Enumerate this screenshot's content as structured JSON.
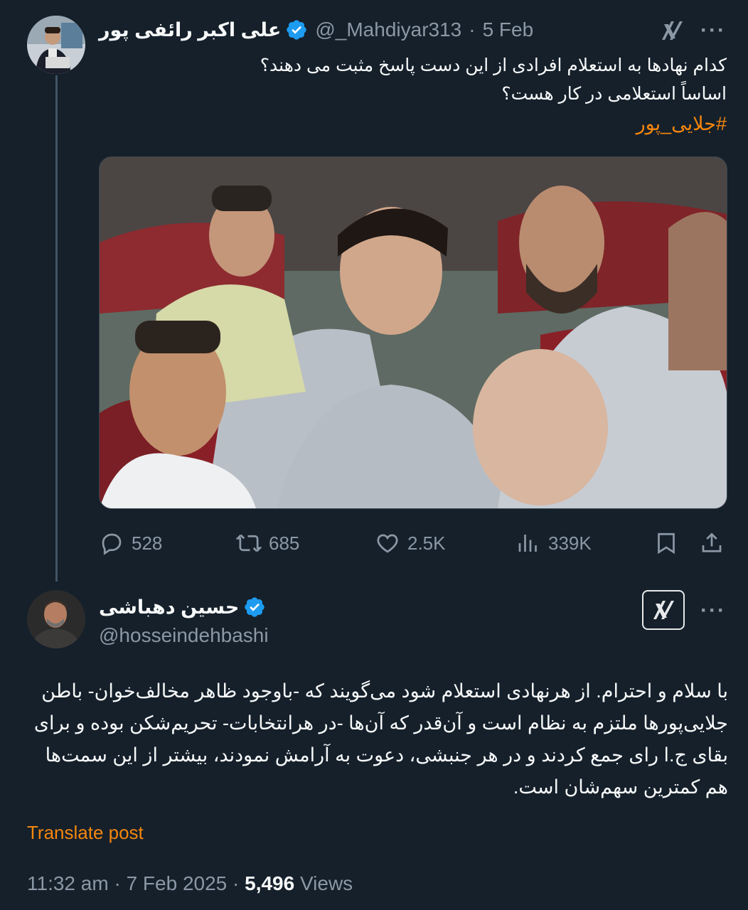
{
  "tweet1": {
    "author_name": "علی اکبر رائفی پور",
    "handle": "@_Mahdiyar313",
    "separator": "·",
    "date": "5 Feb",
    "line1": "کدام نهادها به استعلام افرادی از این دست پاسخ مثبت می دهند؟",
    "line2": "اساساً استعلامی در کار هست؟",
    "hashtag": "#جلایی_پور",
    "more": "···",
    "stats": {
      "replies": "528",
      "reposts": "685",
      "likes": "2.5K",
      "views": "339K"
    }
  },
  "tweet2": {
    "author_name": "حسین دهباشی",
    "handle": "@hosseindehbashi",
    "more": "···",
    "text": "با سلام و احترام. از هرنهادی استعلام شود می‌گویند که -باوجود ظاهر مخالف‌خوان- باطن جلایی‌پورها ملتزم به نظام است و آن‌قدر که آن‌ها -در هرانتخابات- تحریم‌شکن بوده و برای بقای ج.ا رای جمع کردند و در هر جنبشی، دعوت به آرامش نمودند، بیشتر از این سمت‌ها هم کمترین سهم‌شان است.",
    "translate": "Translate post",
    "time": "11:32 am",
    "date": "7 Feb 2025",
    "views_count": "5,496",
    "views_label": "Views"
  },
  "icons": [
    "verified-badge-icon",
    "grok-icon",
    "more-icon",
    "reply-icon",
    "repost-icon",
    "like-icon",
    "views-icon",
    "bookmark-icon",
    "share-icon"
  ],
  "colors": {
    "background": "#15202b",
    "accent": "#f4860e",
    "verified": "#1d9bf0",
    "muted": "#8b98a5"
  }
}
